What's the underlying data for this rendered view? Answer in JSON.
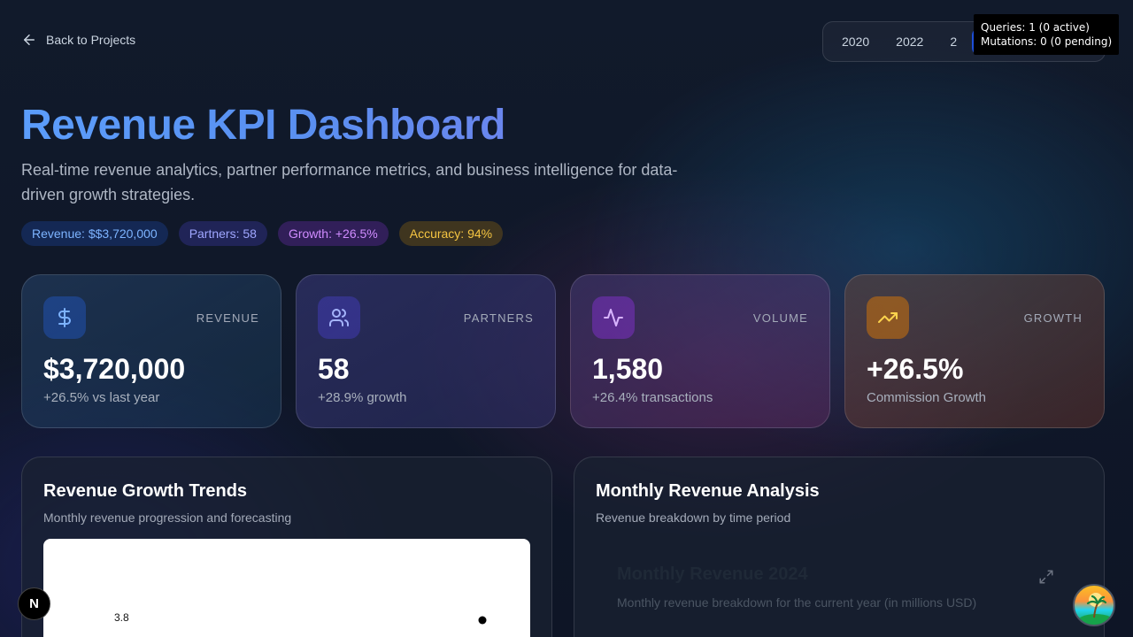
{
  "nav": {
    "back_label": "Back to Projects"
  },
  "year_tabs": [
    {
      "label": "2020",
      "active": false
    },
    {
      "label": "2022",
      "active": false
    },
    {
      "label": "2",
      "active": false
    },
    {
      "label": "",
      "active": true
    }
  ],
  "devtools_tooltip": {
    "queries": "Queries: 1 (0 active)",
    "mutations": "Mutations: 0 (0 pending)"
  },
  "hero": {
    "title": "Revenue KPI Dashboard",
    "subtitle": "Real-time revenue analytics, partner performance metrics, and business intelligence for data-driven growth strategies."
  },
  "badges": [
    {
      "label": "Revenue: $$3,720,000",
      "color": "#7db3ff"
    },
    {
      "label": "Partners: 58",
      "color": "#9fa6ff"
    },
    {
      "label": "Growth: +26.5%",
      "color": "#d08cff"
    },
    {
      "label": "Accuracy: 94%",
      "color": "#f5c542"
    }
  ],
  "kpis": [
    {
      "label": "REVENUE",
      "value": "$3,720,000",
      "sub": "+26.5% vs last year",
      "icon": "dollar-icon"
    },
    {
      "label": "PARTNERS",
      "value": "58",
      "sub": "+28.9% growth",
      "icon": "users-icon"
    },
    {
      "label": "VOLUME",
      "value": "1,580",
      "sub": "+26.4% transactions",
      "icon": "activity-icon"
    },
    {
      "label": "GROWTH",
      "value": "+26.5%",
      "sub": "Commission Growth",
      "icon": "trending-up-icon"
    }
  ],
  "growth_panel": {
    "title": "Revenue Growth Trends",
    "subtitle": "Monthly revenue progression and forecasting",
    "chart_tick": "3.8"
  },
  "monthly_panel": {
    "title": "Monthly Revenue Analysis",
    "subtitle": "Revenue breakdown by time period",
    "card_title": "Monthly Revenue 2024",
    "card_subtitle": "Monthly revenue breakdown for the current year (in millions USD)"
  },
  "next_badge": {
    "letter": "N"
  }
}
